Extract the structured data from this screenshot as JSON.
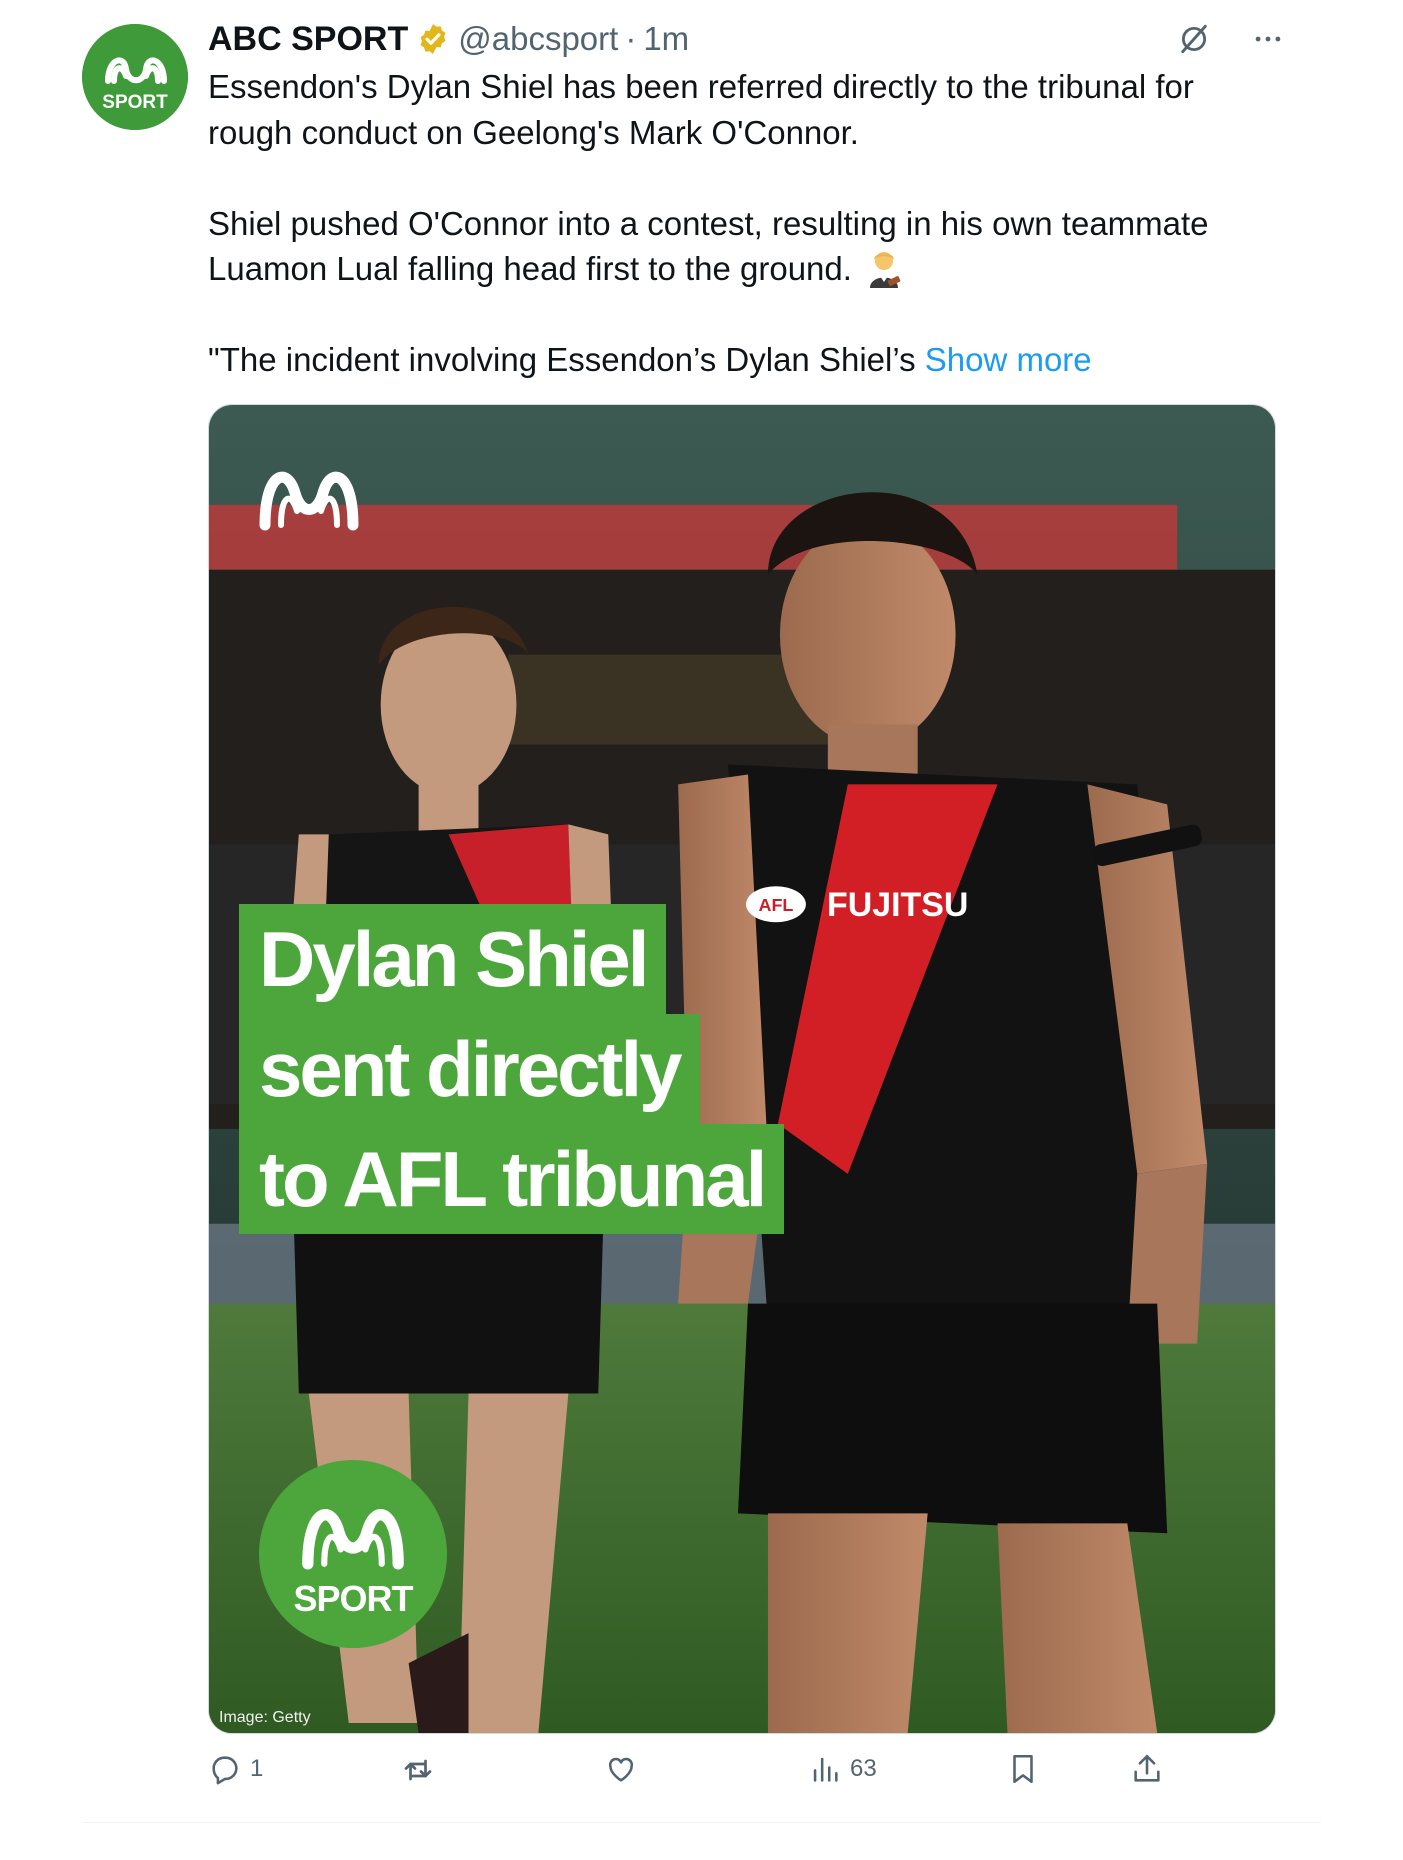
{
  "author": {
    "display_name": "ABC SPORT",
    "handle": "@abcsport",
    "separator": "·",
    "time": "1m",
    "avatar_text": "SPORT"
  },
  "tweet": {
    "lines": [
      "Essendon's Dylan Shiel has been referred directly to the tribunal for",
      "rough conduct on Geelong's Mark O'Connor.",
      "Shiel pushed O'Connor into a contest, resulting in his own teammate",
      "Luamon Lual falling head first to the ground.",
      "\"The incident involving Essendon’s Dylan Shiel’s"
    ],
    "show_more": "Show more"
  },
  "media": {
    "headline": [
      "Dylan Shiel",
      "sent directly",
      "to AFL tribunal"
    ],
    "badge_text": "SPORT",
    "credit": "Image: Getty",
    "jersey_sponsor": "FUJITSU",
    "jersey_badge": "AFL"
  },
  "actions": {
    "replies": "1",
    "reposts": "",
    "likes": "",
    "views": "63"
  },
  "icons": [
    "verified-badge-icon",
    "grok-icon",
    "more-icon",
    "reply-icon",
    "repost-icon",
    "like-icon",
    "views-icon",
    "bookmark-icon",
    "share-icon"
  ],
  "colors": {
    "abc_green": "#4ca63c",
    "link_blue": "#1d9bf0",
    "muted_gray": "#536471",
    "verified_gold": "#e2b719"
  }
}
